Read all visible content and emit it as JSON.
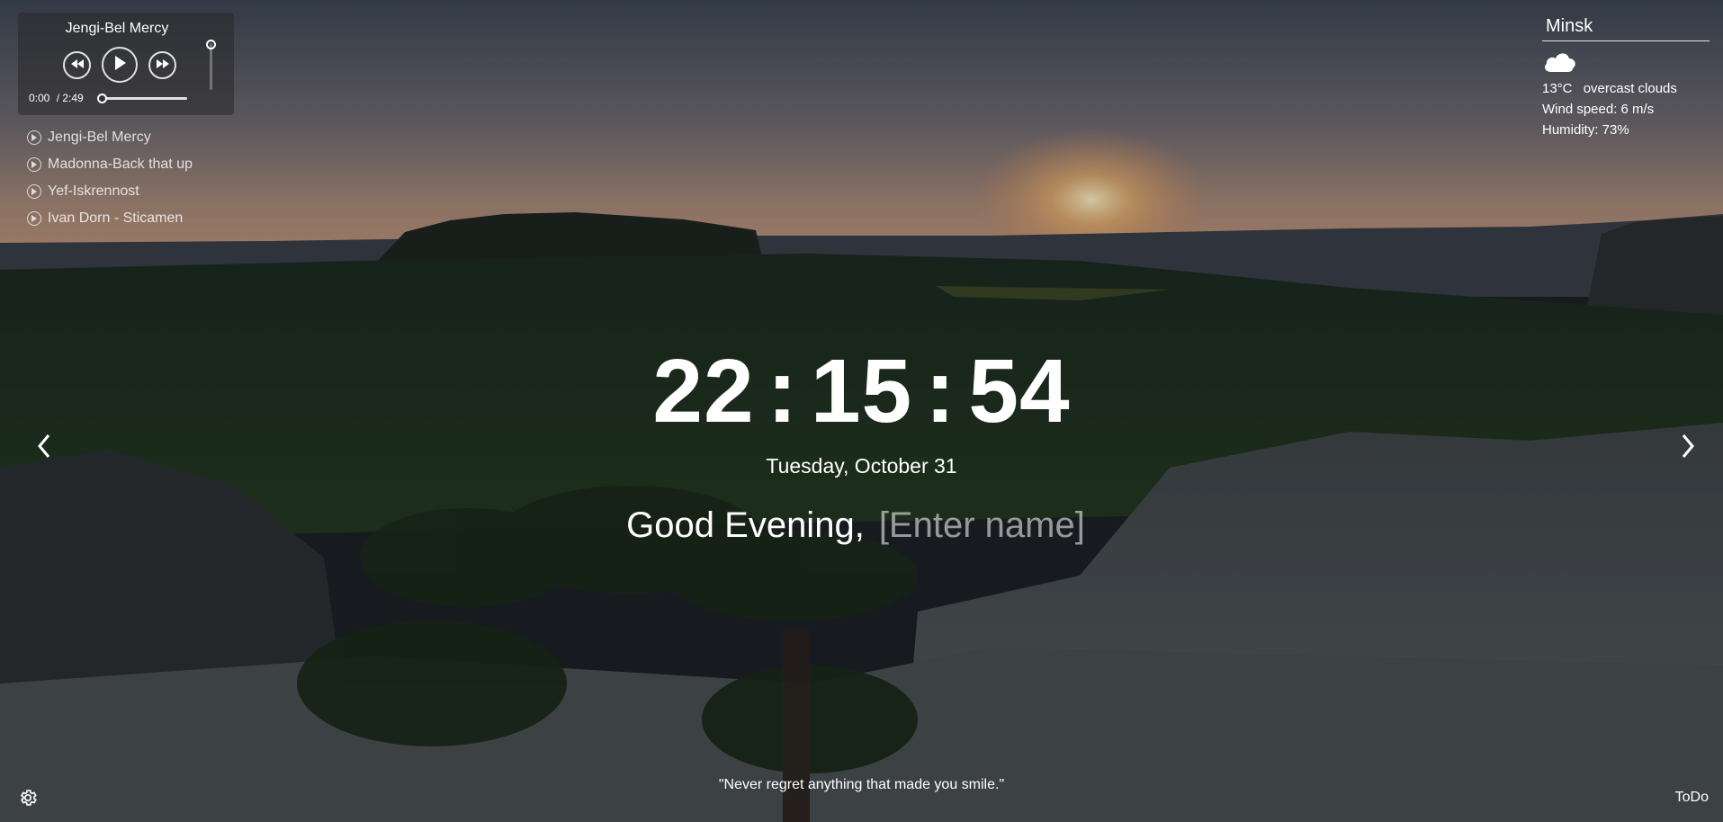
{
  "player": {
    "track_title": "Jengi-Bel Mercy",
    "current_time": "0:00",
    "duration": "/ 2:49",
    "progress_fraction": 0.0,
    "volume_fraction": 1.0,
    "playlist": [
      {
        "label": "Jengi-Bel Mercy"
      },
      {
        "label": "Madonna-Back that up"
      },
      {
        "label": "Yef-Iskrennost"
      },
      {
        "label": "Ivan Dorn - Sticamen"
      }
    ]
  },
  "weather": {
    "city": "Minsk",
    "icon": "cloud-icon",
    "temperature": "13°C",
    "description": "overcast clouds",
    "wind": "Wind speed: 6 m/s",
    "humidity": "Humidity: 73%"
  },
  "clock": {
    "hours": "22",
    "minutes": "15",
    "seconds": "54",
    "separator": ":"
  },
  "date": "Tuesday, October 31",
  "greeting": {
    "text": "Good Evening,",
    "name_placeholder": "[Enter name]"
  },
  "quote": "\"Never regret anything that made you smile.\"",
  "todo_label": "ToDo",
  "colors": {
    "text": "#ffffff",
    "player_bg": "rgba(40,40,40,0.55)"
  }
}
